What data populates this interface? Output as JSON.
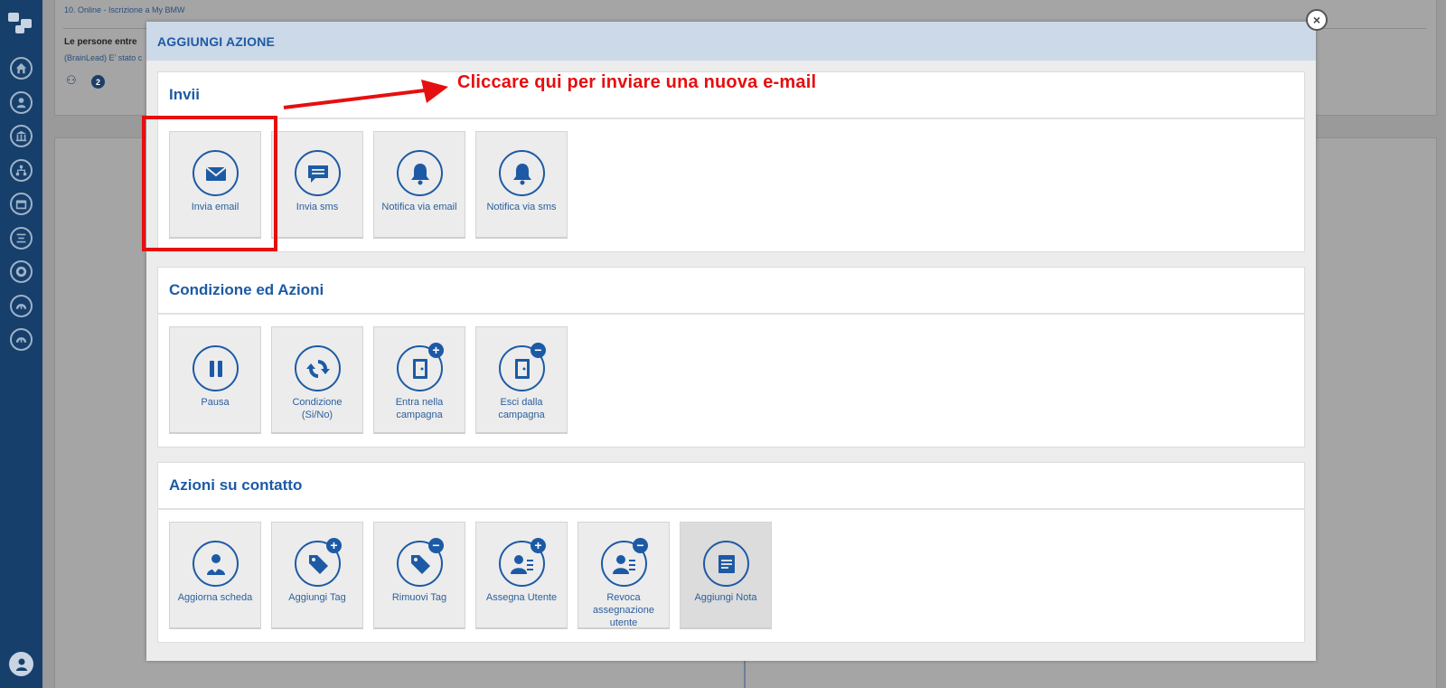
{
  "background": {
    "breadcrumb_link": "10. Online - Iscrizione a My BMW",
    "section_heading": "Le persone entre",
    "sub_text": "(BrainLead) E' stato c",
    "badge_count": "2"
  },
  "modal": {
    "title": "AGGIUNGI AZIONE",
    "close_icon": "×",
    "sections": [
      {
        "title": "Invii",
        "tiles": [
          {
            "label": "Invia email",
            "icon": "envelope-icon"
          },
          {
            "label": "Invia sms",
            "icon": "chat-icon"
          },
          {
            "label": "Notifica via email",
            "icon": "bell-icon"
          },
          {
            "label": "Notifica via sms",
            "icon": "bell-icon"
          }
        ]
      },
      {
        "title": "Condizione ed Azioni",
        "tiles": [
          {
            "label": "Pausa",
            "icon": "pause-icon"
          },
          {
            "label": "Condizione (Si/No)",
            "icon": "cycle-icon"
          },
          {
            "label": "Entra nella campagna",
            "icon": "door-enter-icon"
          },
          {
            "label": "Esci dalla campagna",
            "icon": "door-exit-icon"
          }
        ]
      },
      {
        "title": "Azioni su contatto",
        "tiles": [
          {
            "label": "Aggiorna scheda",
            "icon": "user-check-icon"
          },
          {
            "label": "Aggiungi Tag",
            "icon": "tag-add-icon"
          },
          {
            "label": "Rimuovi Tag",
            "icon": "tag-remove-icon"
          },
          {
            "label": "Assegna Utente",
            "icon": "user-assign-icon"
          },
          {
            "label": "Revoca assegnazione utente",
            "icon": "user-revoke-icon"
          },
          {
            "label": "Aggiungi Nota",
            "icon": "note-icon"
          }
        ]
      }
    ]
  },
  "annotation": {
    "text": "Cliccare qui per inviare una nuova e-mail",
    "color": "#e60f0f"
  },
  "colors": {
    "sidebar": "#163f6b",
    "accent": "#1d5aa5",
    "modal_header": "#ccd9e8"
  }
}
